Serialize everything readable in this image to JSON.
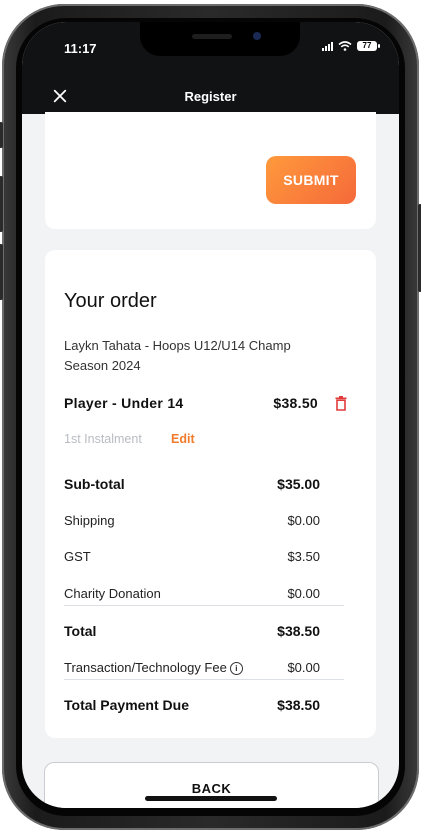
{
  "status": {
    "time": "11:17",
    "battery": "77"
  },
  "header": {
    "title": "Register",
    "close_icon": "close-icon"
  },
  "submit": {
    "label": "SUBMIT"
  },
  "order": {
    "title": "Your order",
    "description": "Laykn Tahata - Hoops U12/U14 Champ Season 2024",
    "item": {
      "name": "Player - Under 14",
      "price": "$38.50"
    },
    "instalment": "1st Instalment",
    "edit_label": "Edit",
    "rows": {
      "subtotal": {
        "label": "Sub-total",
        "value": "$35.00"
      },
      "shipping": {
        "label": "Shipping",
        "value": "$0.00"
      },
      "gst": {
        "label": "GST",
        "value": "$3.50"
      },
      "charity": {
        "label": "Charity Donation",
        "value": "$0.00"
      },
      "total": {
        "label": "Total",
        "value": "$38.50"
      },
      "fee": {
        "label": "Transaction/Technology Fee",
        "value": "$0.00"
      },
      "due": {
        "label": "Total Payment Due",
        "value": "$38.50"
      }
    }
  },
  "back": {
    "label": "BACK"
  },
  "colors": {
    "accent": "#f07b2d",
    "delete": "#e23b3b",
    "header_bg": "#111214"
  }
}
